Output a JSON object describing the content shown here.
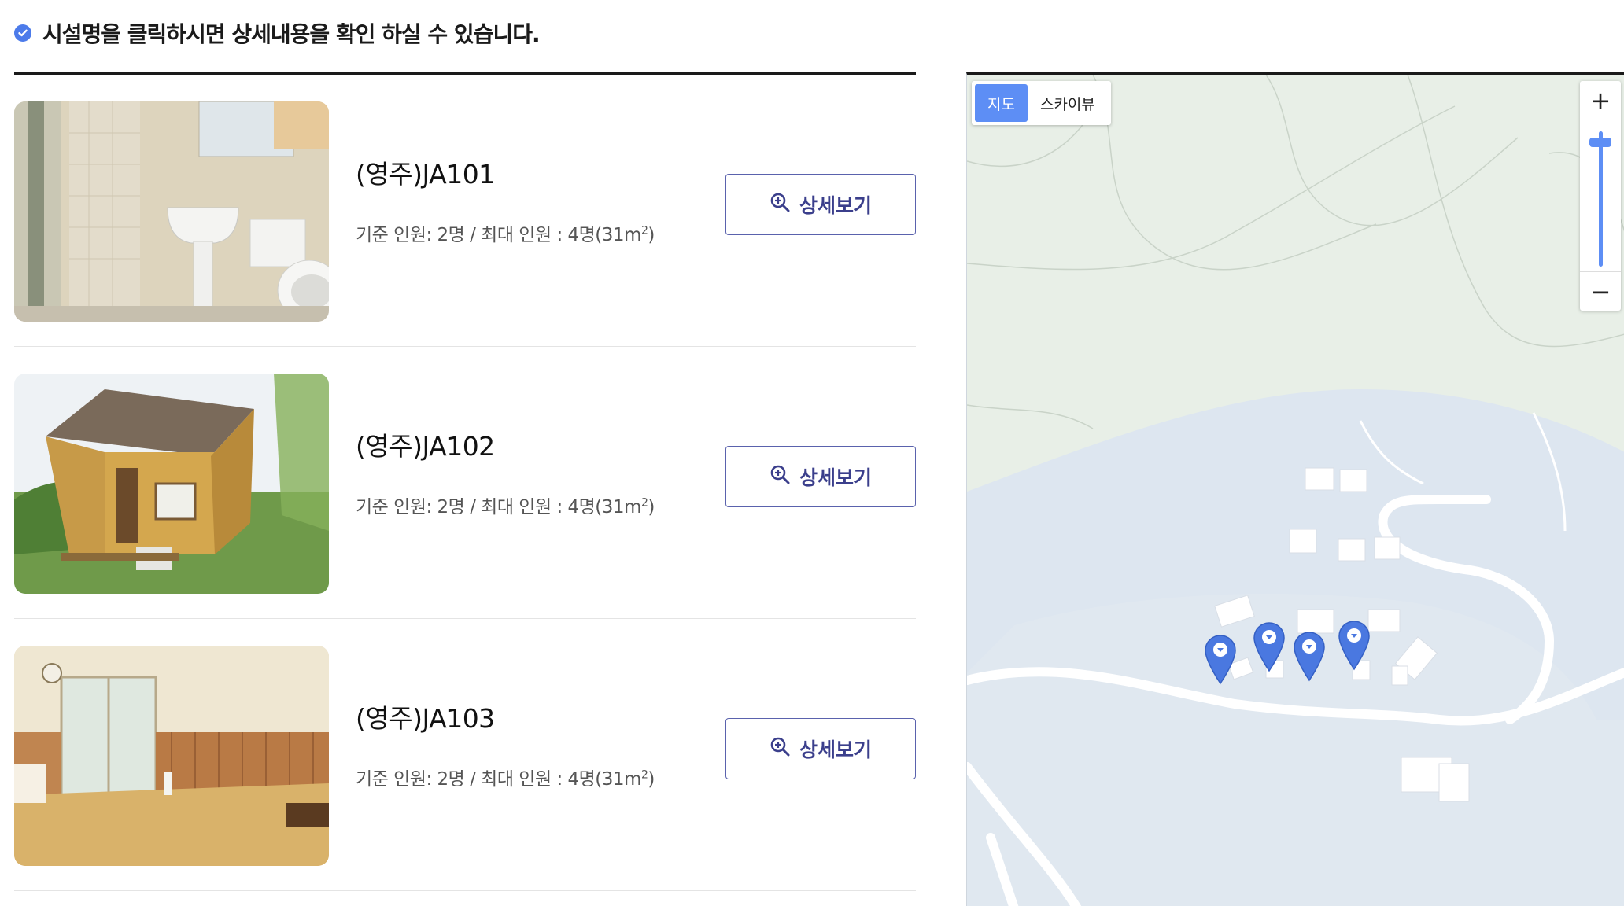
{
  "notice": {
    "text": "시설명을 클릭하시면 상세내용을 확인 하실 수 있습니다."
  },
  "facilities": [
    {
      "name": "(영주)JA101",
      "capacity": "기준 인원: 2명 / 최대 인원 : 4명(31m",
      "capacity_sup": "2",
      "capacity_end": ")",
      "detail_label": "상세보기"
    },
    {
      "name": "(영주)JA102",
      "capacity": "기준 인원: 2명 / 최대 인원 : 4명(31m",
      "capacity_sup": "2",
      "capacity_end": ")",
      "detail_label": "상세보기"
    },
    {
      "name": "(영주)JA103",
      "capacity": "기준 인원: 2명 / 최대 인원 : 4명(31m",
      "capacity_sup": "2",
      "capacity_end": ")",
      "detail_label": "상세보기"
    }
  ],
  "map": {
    "type_tabs": [
      {
        "label": "지도",
        "active": true
      },
      {
        "label": "스카이뷰",
        "active": false
      }
    ],
    "zoom_in": "+",
    "zoom_out": "−",
    "marker_color": "#4a78e0",
    "water_color": "#dde6f0",
    "land_color": "#e8efe7"
  },
  "icons": {
    "notice": "check-circle-icon",
    "detail": "zoom-in-icon",
    "marker": "map-pin-icon"
  }
}
